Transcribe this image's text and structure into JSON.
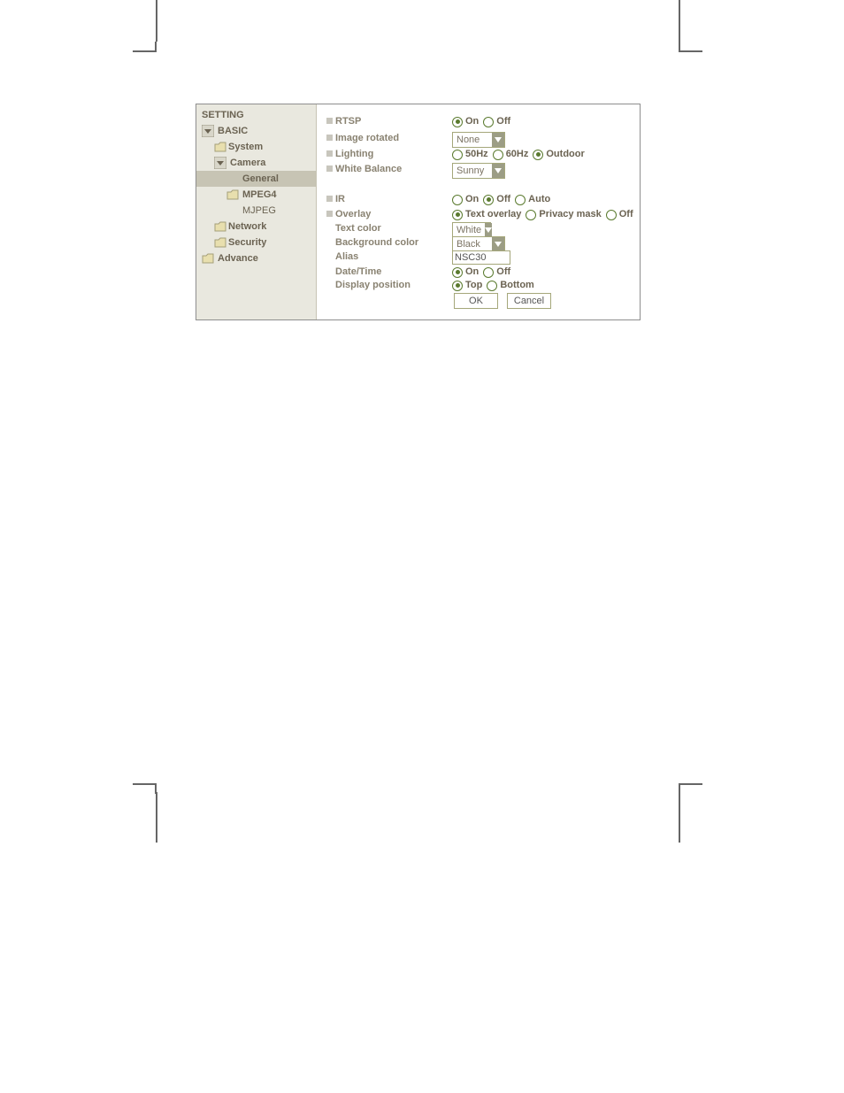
{
  "sidebar": {
    "title": "SETTING",
    "basic": "BASIC",
    "system": "System",
    "camera": "Camera",
    "general": "General",
    "mpeg4": "MPEG4",
    "mjpeg": "MJPEG",
    "network": "Network",
    "security": "Security",
    "advance": "Advance"
  },
  "rtsp": {
    "label": "RTSP",
    "on": "On",
    "off": "Off",
    "selected": "on"
  },
  "image_rotated": {
    "label": "Image rotated",
    "value": "None"
  },
  "lighting": {
    "label": "Lighting",
    "hz50": "50Hz",
    "hz60": "60Hz",
    "outdoor": "Outdoor",
    "selected": "outdoor"
  },
  "white_balance": {
    "label": "White Balance",
    "value": "Sunny"
  },
  "ir": {
    "label": "IR",
    "on": "On",
    "off": "Off",
    "auto": "Auto",
    "selected": "off"
  },
  "overlay": {
    "label": "Overlay",
    "text_overlay": "Text overlay",
    "privacy_mask": "Privacy mask",
    "off": "Off",
    "selected": "text_overlay",
    "text_color": {
      "label": "Text color",
      "value": "White"
    },
    "bg_color": {
      "label": "Background color",
      "value": "Black"
    },
    "alias": {
      "label": "Alias",
      "value": "NSC30"
    },
    "datetime": {
      "label": "Date/Time",
      "on": "On",
      "off": "Off",
      "selected": "on"
    },
    "position": {
      "label": "Display position",
      "top": "Top",
      "bottom": "Bottom",
      "selected": "top"
    }
  },
  "buttons": {
    "ok": "OK",
    "cancel": "Cancel"
  }
}
